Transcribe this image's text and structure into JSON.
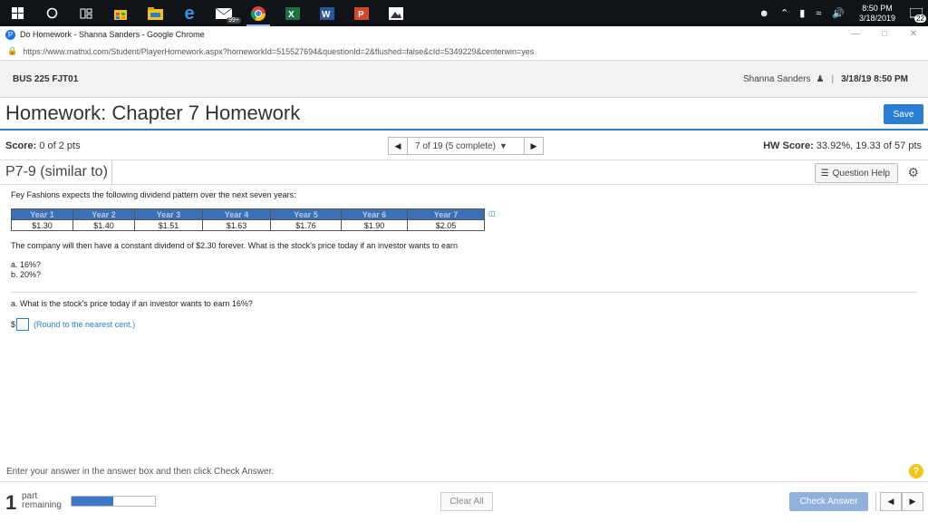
{
  "taskbar": {
    "badge_count": "99+",
    "clock_time": "8:50 PM",
    "clock_date": "3/18/2019",
    "notifications": "22"
  },
  "browser": {
    "window_title": "Do Homework - Shanna Sanders - Google Chrome",
    "url": "https://www.mathxl.com/Student/PlayerHomework.aspx?homeworkId=515527694&questionId=2&flushed=false&cId=5349229&centerwin=yes"
  },
  "header": {
    "course": "BUS 225 FJT01",
    "user": "Shanna Sanders",
    "separator": "|",
    "datetime": "3/18/19 8:50 PM"
  },
  "homework": {
    "title": "Homework: Chapter 7 Homework",
    "save_label": "Save",
    "score_label": "Score:",
    "score_value": "0 of 2 pts",
    "question_nav": "7 of 19 (5 complete)",
    "hw_score_label": "HW Score:",
    "hw_score_value": "33.92%, 19.33 of 57 pts"
  },
  "problem": {
    "id": "P7-9 (similar to)",
    "help_label": "Question Help",
    "intro": "Fey Fashions expects the following dividend pattern over the next seven years:",
    "table": {
      "headers": [
        "Year 1",
        "Year 2",
        "Year 3",
        "Year 4",
        "Year 5",
        "Year 6",
        "Year 7"
      ],
      "values": [
        "$1.30",
        "$1.40",
        "$1.51",
        "$1.63",
        "$1.76",
        "$1.90",
        "$2.05"
      ]
    },
    "question": "The company will then have a constant dividend of $2.30 forever.  What is the stock's price today if an investor wants to earn",
    "part_a": "a.  16%?",
    "part_b": "b.  20%?",
    "part_a_question": "a.  What is the stock's price today if an investor wants to earn 16%?",
    "currency": "$",
    "answer_hint": "(Round to the nearest cent.)"
  },
  "footer": {
    "instruction": "Enter your answer in the answer box and then click Check Answer.",
    "parts_count": "1",
    "parts_label_1": "part",
    "parts_label_2": "remaining",
    "progress": 0.5,
    "clear_label": "Clear All",
    "check_label": "Check Answer"
  }
}
